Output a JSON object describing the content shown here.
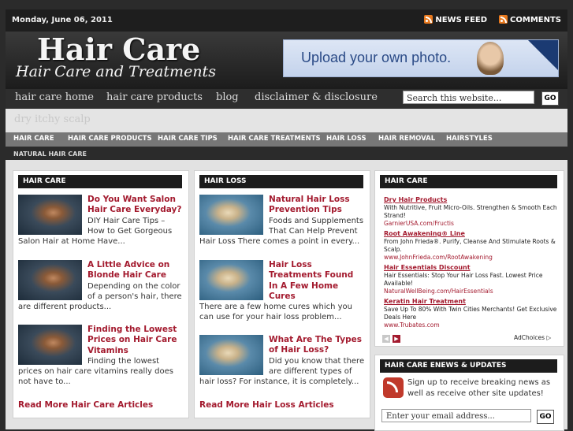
{
  "topbar": {
    "date": "Monday, June 06, 2011",
    "news_feed": "NEWS FEED",
    "comments": "COMMENTS"
  },
  "header": {
    "title": "Hair Care",
    "subtitle": "Hair Care and Treatments",
    "ad_text": "Upload your own photo."
  },
  "nav": {
    "items": [
      "hair care home",
      "hair care products",
      "blog",
      "disclaimer & disclosure"
    ],
    "search_placeholder": "Search this website...",
    "go": "GO"
  },
  "strip": {
    "keyword": "dry itchy scalp"
  },
  "catnav": {
    "items": [
      "HAIR CARE",
      "HAIR CARE PRODUCTS",
      "HAIR CARE TIPS",
      "HAIR CARE TREATMENTS",
      "HAIR LOSS",
      "HAIR REMOVAL",
      "HAIRSTYLES"
    ],
    "sub": "NATURAL HAIR CARE"
  },
  "col1": {
    "heading": "HAIR CARE",
    "articles": [
      {
        "title": "Do You Want Salon Hair Care Everyday?",
        "excerpt": "DIY Hair Care Tips – How to Get Gorgeous Salon Hair at Home Have..."
      },
      {
        "title": "A Little Advice on Blonde Hair Care",
        "excerpt": "Depending on the color of a person's hair, there are different products..."
      },
      {
        "title": "Finding the Lowest Prices on Hair Care Vitamins",
        "excerpt": "Finding the lowest prices on hair care vitamins really does not have to..."
      }
    ],
    "readmore": "Read More Hair Care Articles"
  },
  "col2": {
    "heading": "HAIR LOSS",
    "articles": [
      {
        "title": "Natural Hair Loss Prevention Tips",
        "excerpt": "Foods and Supplements That Can Help Prevent Hair Loss There comes a point in every..."
      },
      {
        "title": "Hair Loss Treatments Found In A Few Home Cures",
        "excerpt": "There are a few home cures which you can use for your hair loss problem..."
      },
      {
        "title": "What Are The Types of Hair Loss?",
        "excerpt": "Did you know that there are different types of hair loss? For instance, it is completely..."
      }
    ],
    "readmore": "Read More Hair Loss Articles"
  },
  "sidebar": {
    "heading": "HAIR CARE",
    "ads": [
      {
        "title": "Dry Hair Products",
        "text": "With Nutritive, Fruit Micro-Oils. Strengthen & Smooth Each Strand!",
        "url": "GarnierUSA.com/Fructis"
      },
      {
        "title": "Root Awakening® Line",
        "text": "From John Frieda®. Purify, Cleanse And Stimulate Roots & Scalp.",
        "url": "www.JohnFrieda.com/RootAwakening"
      },
      {
        "title": "Hair Essentials Discount",
        "text": "Hair Essentials: Stop Your Hair Loss Fast. Lowest Price Available!",
        "url": "NaturalWellBeing.com/HairEssentials"
      },
      {
        "title": "Keratin Hair Treatment",
        "text": "Save Up To 80% With Twin Cities Merchants! Get Exclusive Deals Here",
        "url": "www.Trubates.com"
      }
    ],
    "adchoices": "AdChoices",
    "enews_heading": "HAIR CARE ENEWS & UPDATES",
    "enews_text": "Sign up to receive breaking news as well as receive other site updates!",
    "email_placeholder": "Enter your email address...",
    "go": "GO"
  }
}
